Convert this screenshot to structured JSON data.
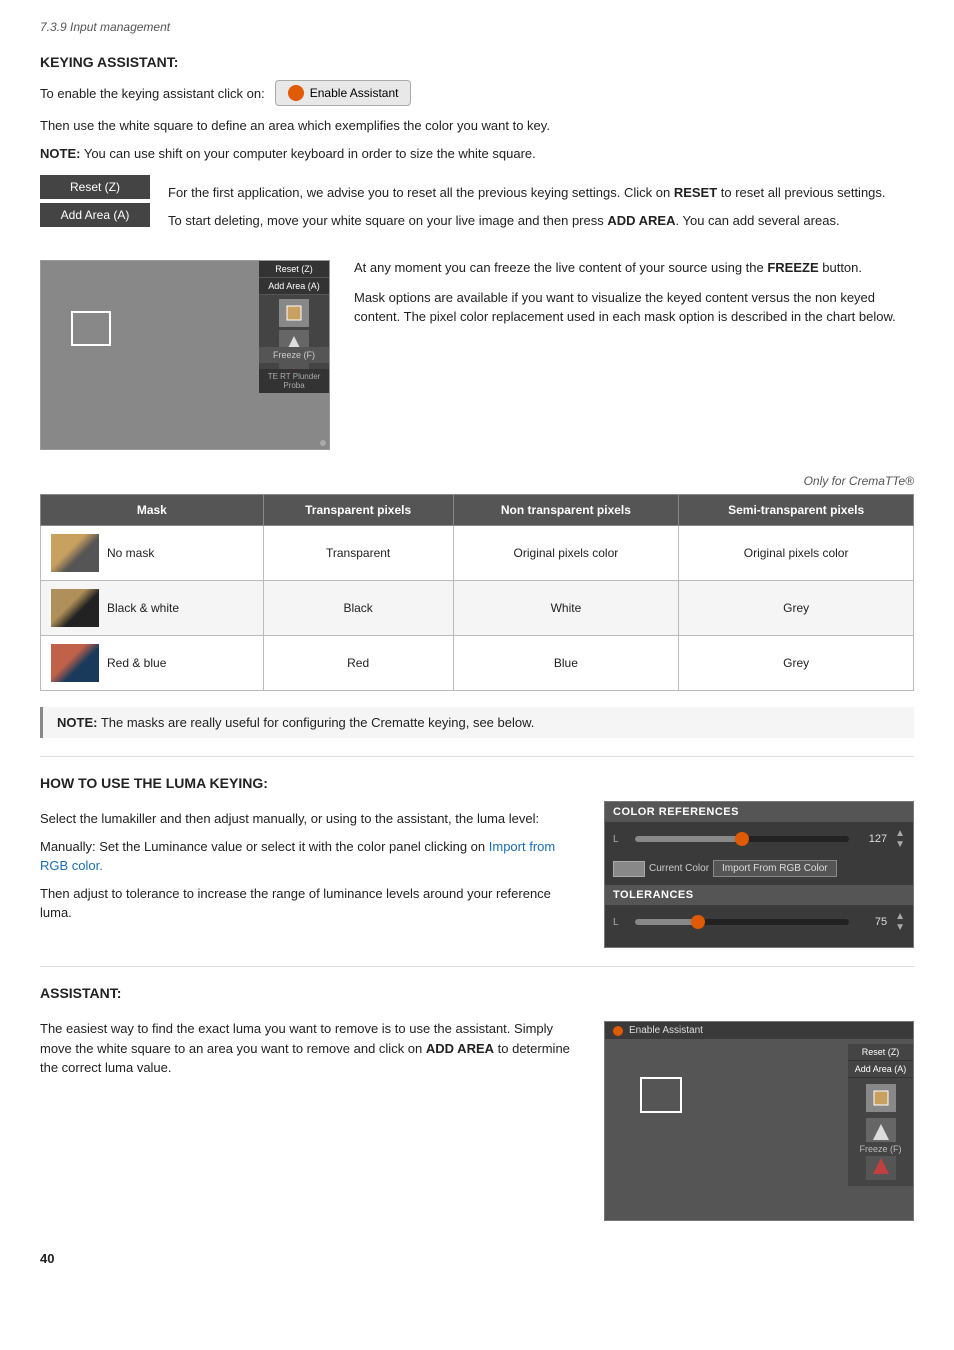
{
  "page": {
    "title": "7.3.9 Input management",
    "page_number": "40"
  },
  "keying_assistant": {
    "heading": "KEYING ASSISTANT:",
    "intro": "To enable the keying assistant click on:",
    "enable_btn_label": "Enable Assistant",
    "para1": "Then use the white square to define an area which exemplifies the color you want to key.",
    "note1_bold": "NOTE:",
    "note1": " You can use shift on your computer keyboard in order to size the white square.",
    "reset_btn": "Reset (Z)",
    "addarea_btn": "Add Area (A)",
    "para2_pre": "For the first application, we advise you to reset all the previous keying settings. Click on ",
    "para2_bold": "RESET",
    "para2_mid": " to reset all previous settings.",
    "para3_pre": "To start deleting, move your white square on your live image and then press ",
    "para3_bold": "ADD AREA",
    "para3_end": ". You can add several areas.",
    "freeze_para_pre": "At any moment you can freeze the live content of your source using the ",
    "freeze_bold": "FREEZE",
    "freeze_end": " button.",
    "mask_para": "Mask options are available if you want to visualize the keyed content versus the non keyed content. The pixel color replacement used in each mask option is described in the chart below.",
    "only_for": "Only for CremaTTe®",
    "table": {
      "headers": [
        "Mask",
        "Transparent pixels",
        "Non transparent pixels",
        "Semi-transparent pixels"
      ],
      "rows": [
        {
          "mask_type": "No mask",
          "transparent": "Transparent",
          "non_transparent": "Original pixels color",
          "semi_transparent": "Original pixels color"
        },
        {
          "mask_type": "Black & white",
          "transparent": "Black",
          "non_transparent": "White",
          "semi_transparent": "Grey"
        },
        {
          "mask_type": "Red & blue",
          "transparent": "Red",
          "non_transparent": "Blue",
          "semi_transparent": "Grey"
        }
      ]
    },
    "note2_bold": "NOTE:",
    "note2": " The masks are really useful for configuring the Crematte keying, see below."
  },
  "luma_keying": {
    "heading": "HOW TO USE THE LUMA KEYING:",
    "para1": "Select the lumakiller and then adjust manually, or using to the assistant, the luma level:",
    "para2": "Manually: Set the Luminance value or select it with the color panel clicking on ",
    "para2_link": "Import from RGB color.",
    "para3": "Then adjust to tolerance to increase the range of luminance levels around your reference luma.",
    "color_ref_header": "COLOR REFERENCES",
    "color_ref_label": "L",
    "color_ref_value": "127",
    "current_color_label": "Current Color",
    "import_btn_label": "Import From RGB Color",
    "tolerances_header": "TOLERANCES",
    "tol_label": "L",
    "tol_value": "75"
  },
  "assistant": {
    "heading": "ASSISTANT:",
    "para1": "The easiest way to find the exact luma you want to remove is to use the assistant. Simply move the white square to an area you want to remove and click on ",
    "para1_bold": "ADD AREA",
    "para1_end": " to determine the correct luma value.",
    "enable_label": "Enable Assistant",
    "reset_btn": "Reset (Z)",
    "addarea_btn": "Add Area (A)",
    "freeze_btn": "Freeze (F)"
  },
  "toolbar": {
    "reset_z": "Reset (Z)",
    "add_area_a": "Add Area (A)",
    "freeze_f": "Freeze (F)"
  }
}
